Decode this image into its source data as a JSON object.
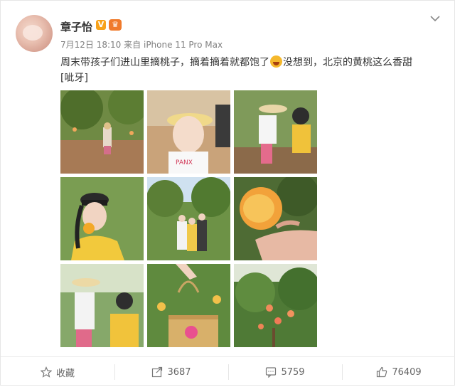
{
  "post": {
    "author": "章子怡",
    "verified_badge": "V",
    "time": "7月12日 18:10",
    "source_prefix": "来自",
    "source": "iPhone 11 Pro Max",
    "text_before": "周末带孩子们进山里摘桃子，摘着摘着就都饱了",
    "text_after": "没想到，北京的黄桃这么香甜",
    "text_tail": "[呲牙]",
    "inline_emoji_icon": "laughing-emoji-icon"
  },
  "photos": [
    {
      "desc": "peach-orchard-child-walking"
    },
    {
      "desc": "child-with-straw-visor"
    },
    {
      "desc": "two-children-in-orchard"
    },
    {
      "desc": "woman-eating-peach"
    },
    {
      "desc": "family-in-orchard"
    },
    {
      "desc": "hand-holding-bitten-peach"
    },
    {
      "desc": "mother-and-child-orchard"
    },
    {
      "desc": "straw-basket-with-peaches"
    },
    {
      "desc": "peach-tree-fruit"
    }
  ],
  "actions": {
    "favorite_label": "收藏",
    "repost_count": "3687",
    "comment_count": "5759",
    "like_count": "76409"
  },
  "colors": {
    "brand_orange": "#f7a21b",
    "meta_gray": "#808080"
  }
}
